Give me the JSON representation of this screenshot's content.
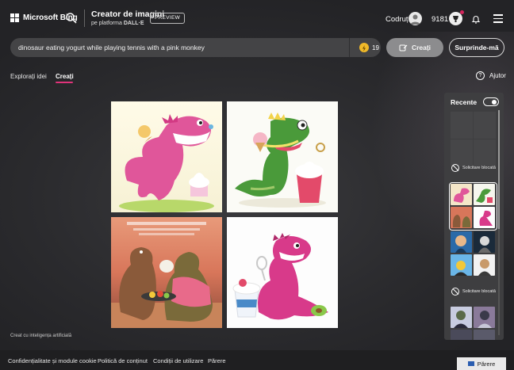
{
  "header": {
    "brand": "Microsoft Bing",
    "app_title": "Creator de imagini",
    "app_subtitle_prefix": "pe platforma",
    "app_subtitle_brand": "DALL·E",
    "preview_badge": "PREVIEW",
    "user_name": "Codruț",
    "rewards_points": "9181"
  },
  "prompt": {
    "value": "dinosaur eating yogurt while playing tennis with a pink monkey",
    "boosts_remaining": "19",
    "create_label": "Creați",
    "surprise_label": "Surprinde-mă"
  },
  "tabs": {
    "explore": "Explorați idei",
    "create": "Creați",
    "active": "create"
  },
  "help_label": "Ajutor",
  "results": {
    "images": [
      {
        "icon": "pink-dinosaur-with-ice-cream-image"
      },
      {
        "icon": "green-dinosaur-with-yogurt-cup-image"
      },
      {
        "icon": "dinosaurs-eating-ice-cream-image"
      },
      {
        "icon": "pink-dinosaur-with-yogurt-cup-image"
      }
    ],
    "ai_note": "Creat cu inteligența artificială"
  },
  "recent": {
    "title": "Recente",
    "toggle_on": true,
    "blocked_label_1": "Solicitare blocată",
    "blocked_label_2": "Solicitare blocată"
  },
  "footer": {
    "links": [
      "Confidențialitate și module cookie",
      "Politică de conținut",
      "Condiții de utilizare",
      "Părere"
    ],
    "feedback_button": "Părere"
  },
  "colors": {
    "accent_pink": "#e0337a",
    "boost_gold": "#f0b929"
  }
}
